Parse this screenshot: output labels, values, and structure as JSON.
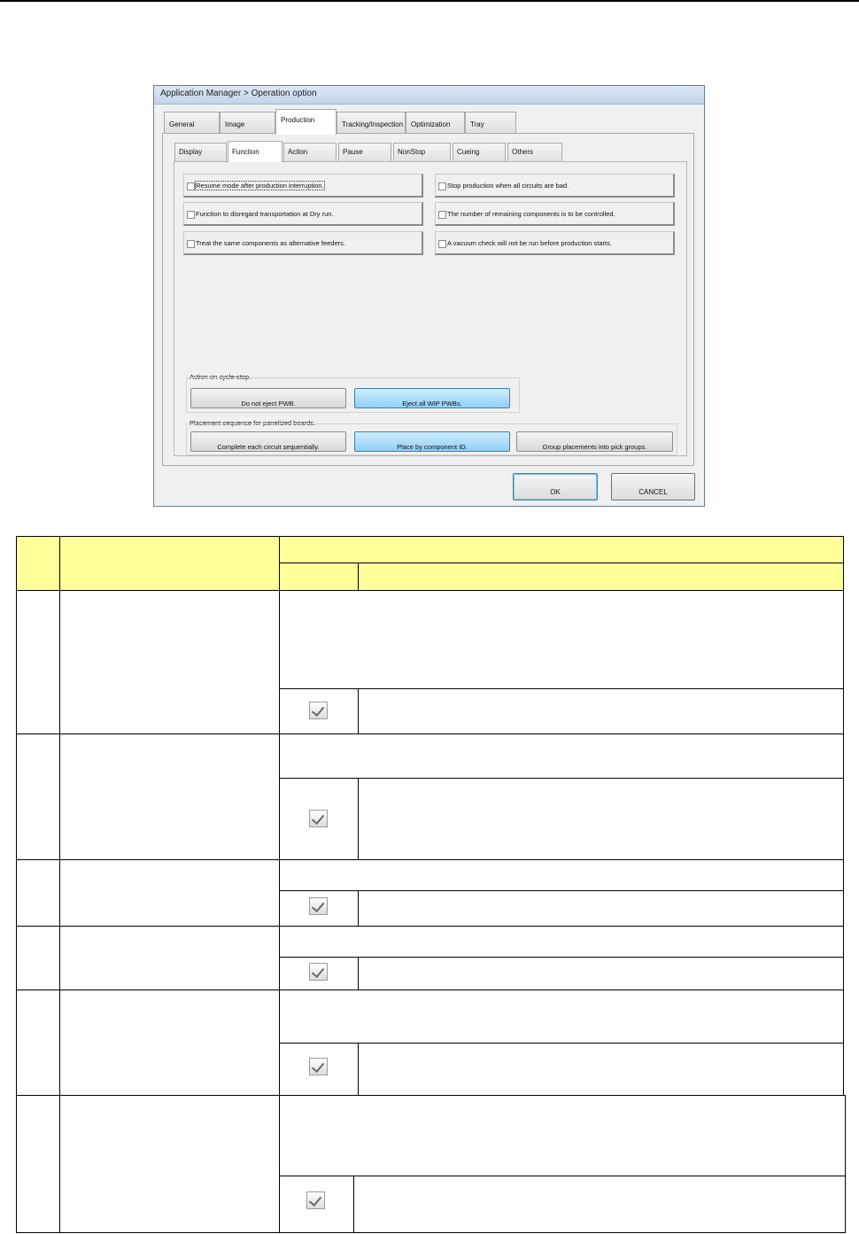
{
  "window": {
    "title": "Application Manager > Operation option"
  },
  "main_tabs": [
    {
      "label": "General",
      "active": false
    },
    {
      "label": "Image",
      "active": false
    },
    {
      "label": "Production",
      "active": true
    },
    {
      "label": "Tracking/Inspection",
      "active": false
    },
    {
      "label": "Optimization",
      "active": false
    },
    {
      "label": "Tray",
      "active": false
    }
  ],
  "sub_tabs": [
    {
      "label": "Display",
      "active": false
    },
    {
      "label": "Function",
      "active": true
    },
    {
      "label": "Action",
      "active": false
    },
    {
      "label": "Pause",
      "active": false
    },
    {
      "label": "NonStop",
      "active": false
    },
    {
      "label": "Cueing",
      "active": false
    },
    {
      "label": "Others",
      "active": false
    }
  ],
  "options": [
    {
      "label": "Resume mode after production interruption.",
      "checked": false
    },
    {
      "label": "Stop production when all circuits are bad.",
      "checked": false
    },
    {
      "label": "Function to disregard transportation at Dry run.",
      "checked": false
    },
    {
      "label": "The number of remaining components is to be controlled.",
      "checked": false
    },
    {
      "label": "Treat the same components as alternative feeders.",
      "checked": false
    },
    {
      "label": "A vacuum check will not be run before production starts.",
      "checked": false
    }
  ],
  "cycle_stop": {
    "label": "Action on cycle-stop.",
    "buttons": [
      {
        "label": "Do not eject PWB.",
        "selected": false
      },
      {
        "label": "Eject all WIP PWBs.",
        "selected": true
      }
    ]
  },
  "placement": {
    "label": "Placement sequence for panelized boards.",
    "buttons": [
      {
        "label": "Complete each circuit sequentially.",
        "selected": false
      },
      {
        "label": "Place by component ID.",
        "selected": true
      },
      {
        "label": "Group placements into pick groups.",
        "selected": false
      }
    ]
  },
  "dialog_buttons": {
    "ok": "OK",
    "cancel": "CANCEL"
  },
  "colors": {
    "table_header": "#ffff99",
    "selected_button": "#8fcff5"
  },
  "table": {
    "rows": 6,
    "row_check_state": "checked"
  }
}
